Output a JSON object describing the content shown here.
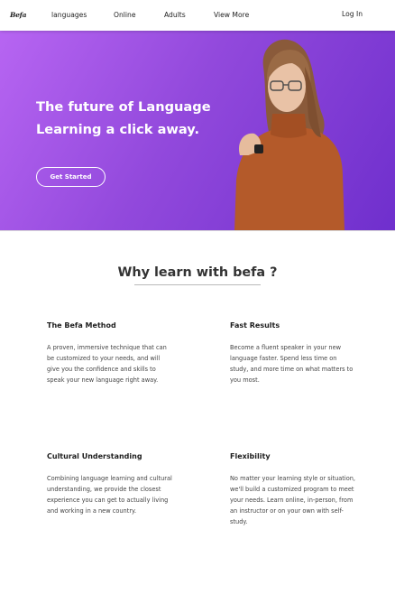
{
  "nav": {
    "logo": "Befa",
    "links": [
      "languages",
      "Online",
      "Adults",
      "View More"
    ],
    "login": "Log In"
  },
  "hero": {
    "title": "The future of Language Learning a click away.",
    "cta": "Get Started",
    "gradient": [
      "#b765f2",
      "#9249dc",
      "#6f2fcd"
    ]
  },
  "section": {
    "title": "Why learn with befa ?"
  },
  "features": [
    {
      "title": "The Befa Method",
      "text": "A proven, immersive technique that can be customized to your needs, and will give you the confidence and skills to speak your new language right away."
    },
    {
      "title": "Fast Results",
      "text": "Become a fluent speaker in your new language faster. Spend less time on study, and more time on what matters to you most."
    },
    {
      "title": "Cultural Understanding",
      "text": "Combining language learning and cultural understanding, we provide the closest experience you can get to actually living and working in a new country."
    },
    {
      "title": "Flexibility",
      "text": "No matter your learning style or situation, we'll build a customized program to meet your needs. Learn online, in-person, from an instructor or on your own with self-study."
    }
  ]
}
